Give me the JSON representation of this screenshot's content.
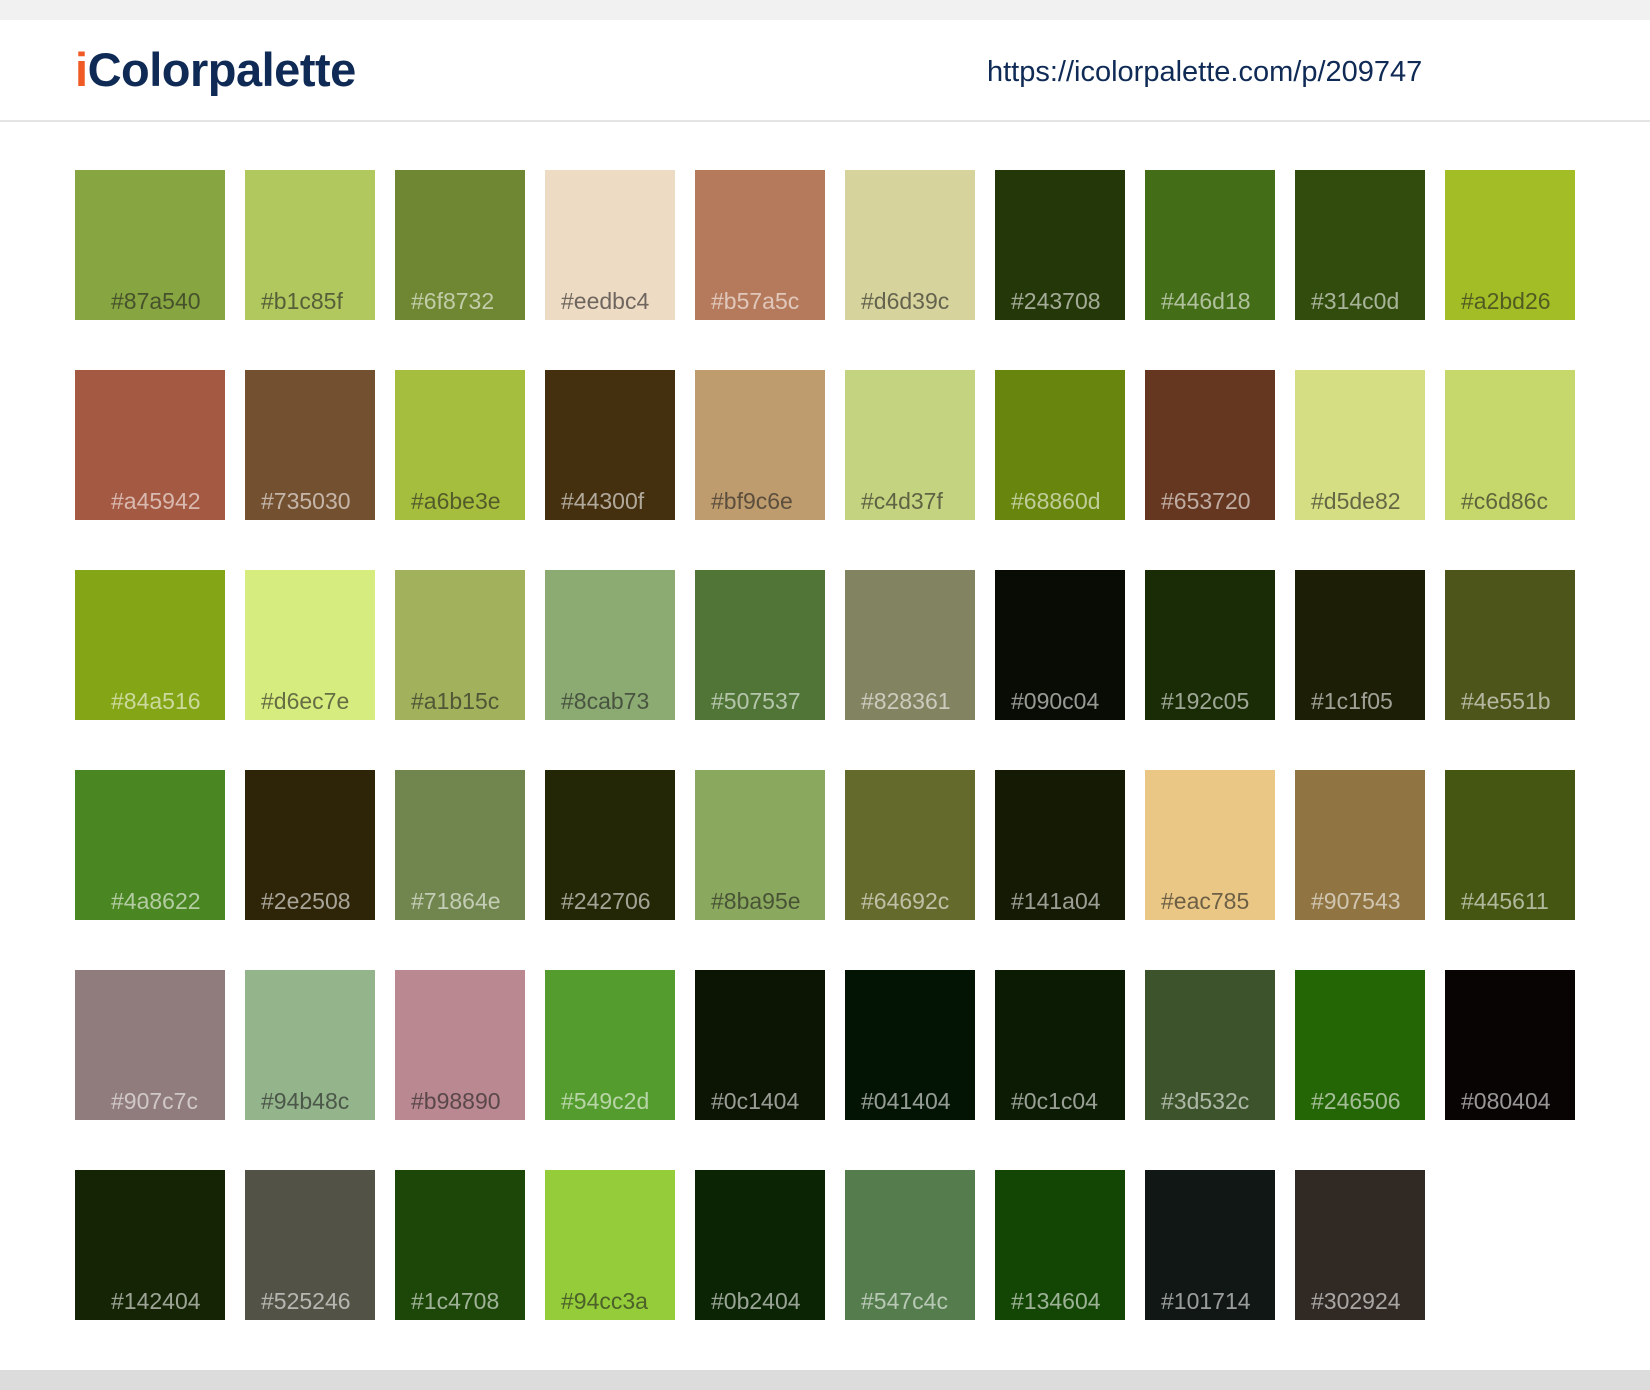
{
  "header": {
    "logo_i": "i",
    "logo_rest": "Colorpalette",
    "url": "https://icolorpalette.com/p/209747"
  },
  "swatches": [
    "#87a540",
    "#b1c85f",
    "#6f8732",
    "#eedbc4",
    "#b57a5c",
    "#d6d39c",
    "#243708",
    "#446d18",
    "#314c0d",
    "#a2bd26",
    "#a45942",
    "#735030",
    "#a6be3e",
    "#44300f",
    "#bf9c6e",
    "#c4d37f",
    "#68860d",
    "#653720",
    "#d5de82",
    "#c6d86c",
    "#84a516",
    "#d6ec7e",
    "#a1b15c",
    "#8cab73",
    "#507537",
    "#828361",
    "#090c04",
    "#192c05",
    "#1c1f05",
    "#4e551b",
    "#4a8622",
    "#2e2508",
    "#71864e",
    "#242706",
    "#8ba95e",
    "#64692c",
    "#141a04",
    "#eac785",
    "#907543",
    "#445611",
    "#907c7c",
    "#94b48c",
    "#b98890",
    "#549c2d",
    "#0c1404",
    "#041404",
    "#0c1c04",
    "#3d532c",
    "#246506",
    "#080404",
    "#142404",
    "#525246",
    "#1c4708",
    "#94cc3a",
    "#0b2404",
    "#547c4c",
    "#134604",
    "#101714",
    "#302924"
  ]
}
